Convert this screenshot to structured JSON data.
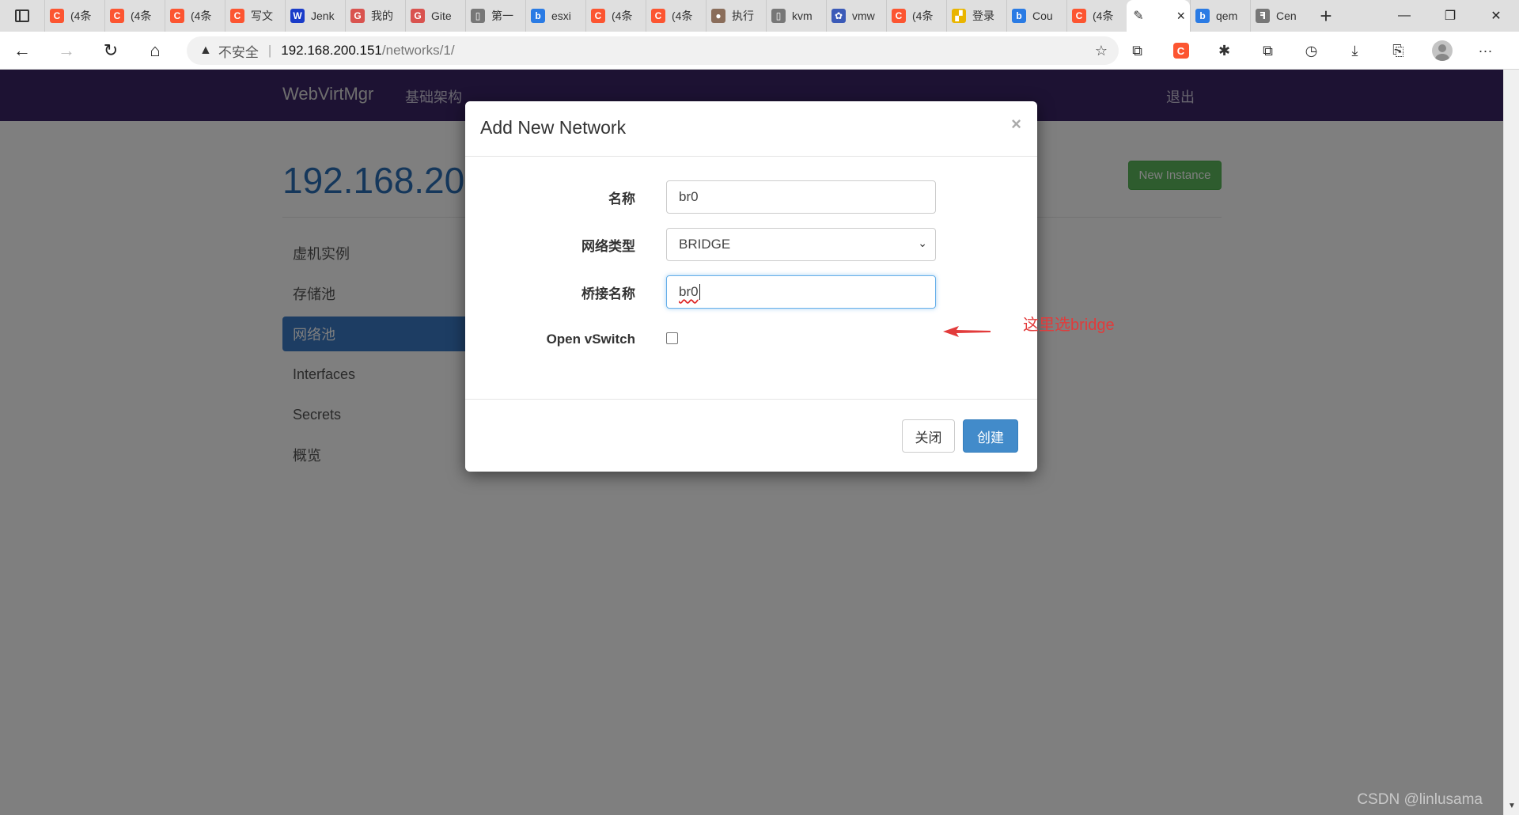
{
  "browser": {
    "tabs": [
      {
        "title": "(4条",
        "favicon": "C",
        "color": "#fc5531"
      },
      {
        "title": "(4条",
        "favicon": "C",
        "color": "#fc5531"
      },
      {
        "title": "(4条",
        "favicon": "C",
        "color": "#fc5531"
      },
      {
        "title": "写文",
        "favicon": "C",
        "color": "#fc5531"
      },
      {
        "title": "Jenk",
        "favicon": "W",
        "color": "#1a3cc9"
      },
      {
        "title": "我的",
        "favicon": "G",
        "color": "#d9534f"
      },
      {
        "title": "Gite",
        "favicon": "G",
        "color": "#d9534f"
      },
      {
        "title": "第一",
        "favicon": "▯",
        "color": "#777777"
      },
      {
        "title": "esxi",
        "favicon": "b",
        "color": "#2a7be4"
      },
      {
        "title": "(4条",
        "favicon": "C",
        "color": "#fc5531"
      },
      {
        "title": "(4条",
        "favicon": "C",
        "color": "#fc5531"
      },
      {
        "title": "执行",
        "favicon": "●",
        "color": "#8a6d5a"
      },
      {
        "title": "kvm",
        "favicon": "▯",
        "color": "#777777"
      },
      {
        "title": "vmw",
        "favicon": "✿",
        "color": "#3b5ab8"
      },
      {
        "title": "(4条",
        "favicon": "C",
        "color": "#fc5531"
      },
      {
        "title": "登录",
        "favicon": "▞",
        "color": "#e9b500"
      },
      {
        "title": "Cou",
        "favicon": "b",
        "color": "#2a7be4"
      },
      {
        "title": "(4条",
        "favicon": "C",
        "color": "#fc5531"
      }
    ],
    "active_tab": {
      "favicon": "✎",
      "close": "×"
    },
    "tabs_after": [
      {
        "title": "qem",
        "favicon": "b",
        "color": "#2a7be4"
      },
      {
        "title": "Cen",
        "favicon": "ꟻ",
        "color": "#777777"
      }
    ],
    "new_tab": "+",
    "window_controls": {
      "minimize": "—",
      "restore": "❐",
      "close": "✕"
    },
    "address": {
      "warning_icon": "▲",
      "insecure_label": "不安全",
      "separator": "|",
      "host": "192.168.200.151",
      "path": "/networks/1/"
    },
    "toolbar_glyphs": {
      "back": "←",
      "forward": "→",
      "reload": "↻",
      "home": "⌂",
      "favorite": "☆",
      "extension": "⧉",
      "csdn": "C",
      "puzzle": "✱",
      "collections": "⧉",
      "history": "◷",
      "download": "⤓",
      "share": "⎘",
      "more": "···"
    }
  },
  "app": {
    "brand": "WebVirtMgr",
    "nav_infrastructure": "基础架构",
    "logout": "退出",
    "host_title": "192.168.200.151",
    "new_instance": "New Instance",
    "side_menu": [
      "虚机实例",
      "存储池",
      "网络池",
      "Interfaces",
      "Secrets",
      "概览"
    ],
    "active_menu_index": 2
  },
  "modal": {
    "title": "Add New Network",
    "close": "×",
    "fields": {
      "name_label": "名称",
      "name_value": "br0",
      "type_label": "网络类型",
      "type_value": "BRIDGE",
      "bridge_label": "桥接名称",
      "bridge_value": "br0",
      "ovs_label": "Open vSwitch",
      "ovs_checked": false
    },
    "close_button": "关闭",
    "create_button": "创建"
  },
  "annotation": {
    "text": "这里选bridge",
    "color": "#e23b3b"
  },
  "watermark": "CSDN @linlusama"
}
